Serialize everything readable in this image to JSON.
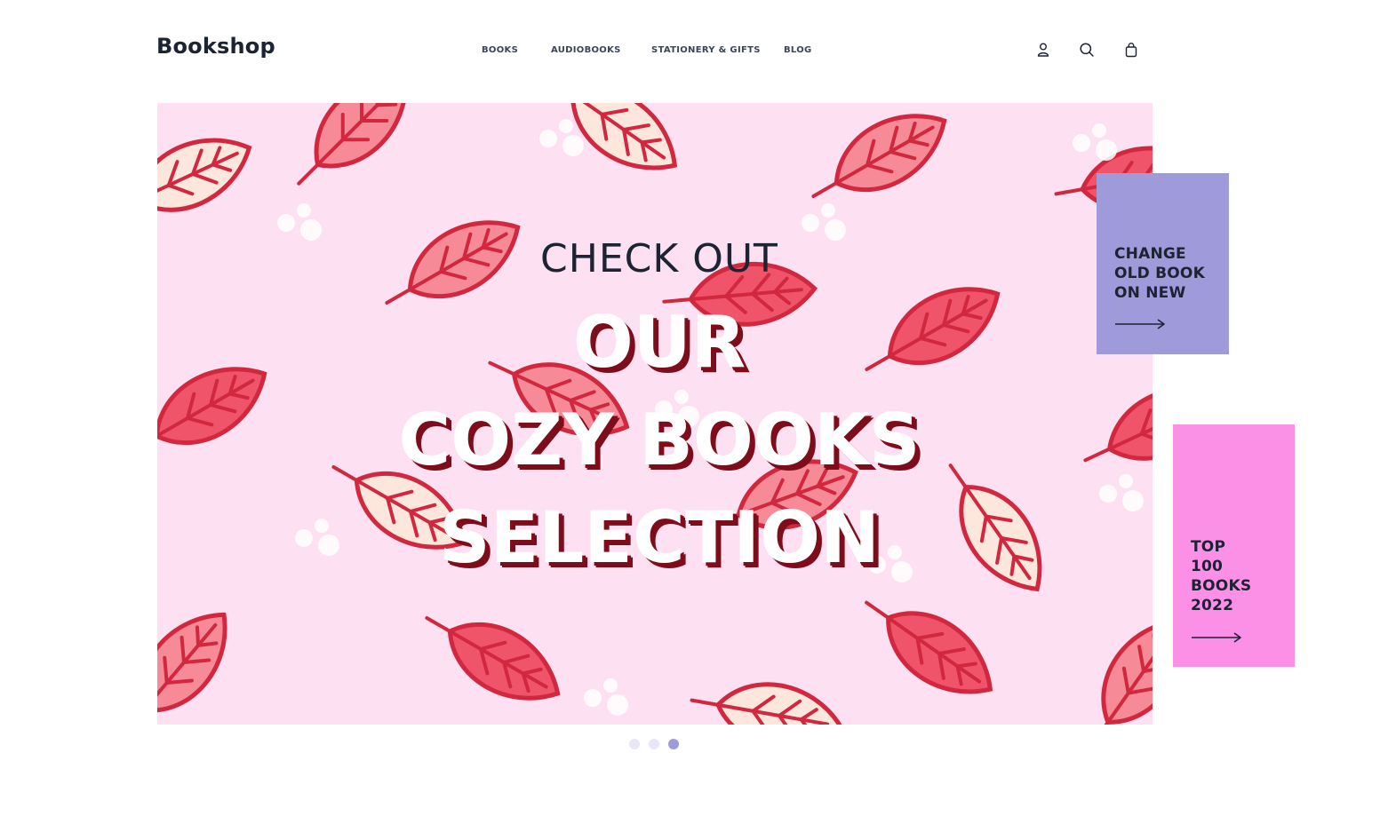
{
  "header": {
    "logo": "Bookshop",
    "nav": [
      {
        "label": "BOOKS"
      },
      {
        "label": "AUDIOBOOKS"
      },
      {
        "label": "STATIONERY & GIFTS"
      },
      {
        "label": "BLOG"
      }
    ],
    "icons": [
      "user-icon",
      "search-icon",
      "shopping-bag-icon"
    ]
  },
  "hero": {
    "kicker": "CHECK OUT",
    "line1": "OUR",
    "line2": "COZY BOOKS",
    "line3": "SELECTION",
    "background_color": "#fde0f1",
    "leaf_colors": [
      "#f0546a",
      "#f78a97",
      "#fde6db",
      "#d7263d"
    ]
  },
  "promos": {
    "change": {
      "line1": "CHANGE",
      "line2": "OLD BOOK",
      "line3": "ON NEW",
      "color": "#9f9ad9",
      "icon": "arrow-right-icon"
    },
    "top": {
      "line1": "TOP",
      "line2": "100",
      "line3": "BOOKS",
      "line4": "2022",
      "color": "#fc8fe6",
      "icon": "arrow-right-icon"
    }
  },
  "slider": {
    "count": 3,
    "active_index": 2
  }
}
